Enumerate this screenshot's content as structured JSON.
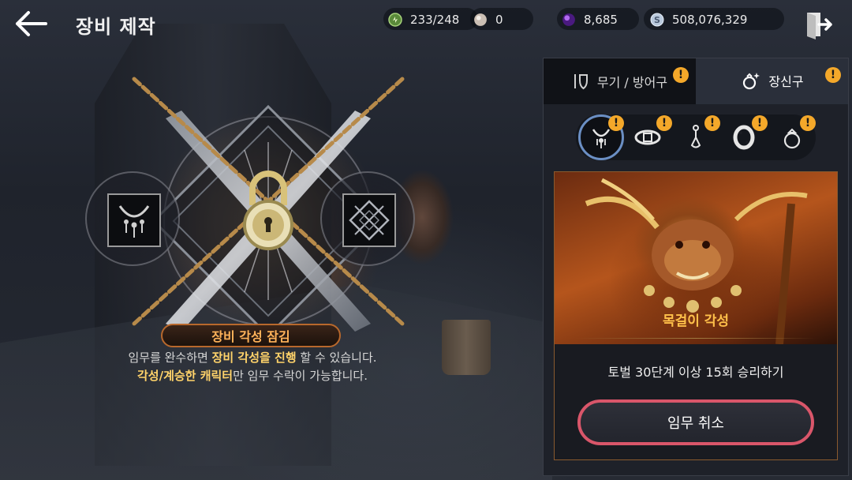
{
  "header": {
    "title": "장비 제작",
    "currencies": [
      {
        "icon": "stamina-icon",
        "value": "233/248",
        "color": "#7fbf5a"
      },
      {
        "icon": "pearl-icon",
        "value": "0",
        "color": "#d9c8b8"
      },
      {
        "icon": "purple-gem-icon",
        "value": "8,685",
        "color": "#8a3fd0"
      },
      {
        "icon": "silver-coin-icon",
        "value": "508,076,329",
        "color": "#c7d5e6"
      }
    ]
  },
  "lock": {
    "banner": "장비 각성 잠김",
    "desc1_a": "임무를 완수하면 ",
    "desc1_hl": "장비 각성을 진행",
    "desc1_b": " 할 수 있습니다.",
    "desc2_hl": "각성/계승한 캐릭터",
    "desc2_b": "만 임무 수락이 가능합니다."
  },
  "panel": {
    "tabs": [
      {
        "label": "무기 / 방어구",
        "active": false
      },
      {
        "label": "장신구",
        "active": true
      }
    ],
    "categories": [
      {
        "icon": "necklace-icon",
        "active": true
      },
      {
        "icon": "belt-icon",
        "active": false
      },
      {
        "icon": "earring-icon",
        "active": false
      },
      {
        "icon": "bracelet-icon",
        "active": false
      },
      {
        "icon": "ring-icon",
        "active": false
      }
    ],
    "card": {
      "title": "목걸이 각성",
      "mission": "토벌 30단계 이상 15회 승리하기",
      "button": "임무 취소"
    },
    "alert_symbol": "!"
  },
  "colors": {
    "accent_orange": "#ffb35a",
    "highlight_yellow": "#ffd36a",
    "alert": "#f4a82a",
    "cancel_border": "#d9566a"
  }
}
